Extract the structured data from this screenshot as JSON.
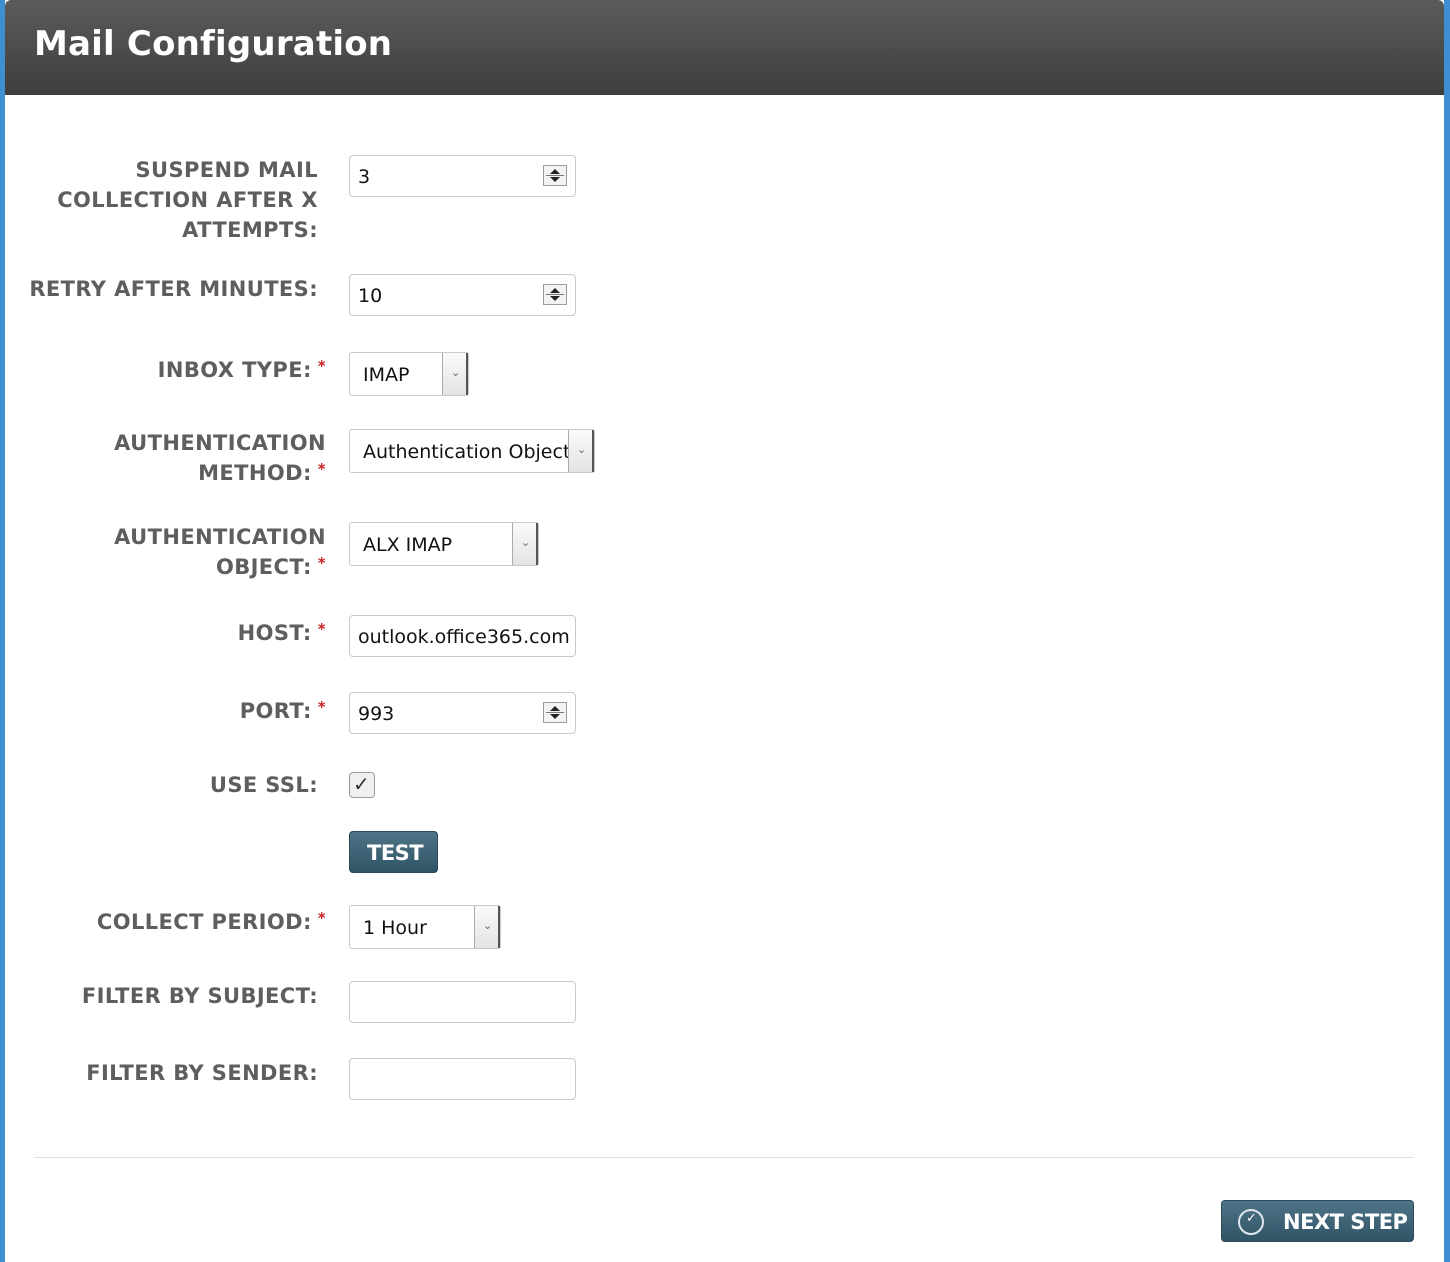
{
  "header": {
    "title": "Mail Configuration"
  },
  "fields": {
    "suspend": {
      "label": "SUSPEND MAIL COLLECTION AFTER X ATTEMPTS:",
      "value": "3"
    },
    "retry": {
      "label": "RETRY AFTER MINUTES:",
      "value": "10"
    },
    "inbox_type": {
      "label": "INBOX TYPE:",
      "value": "IMAP"
    },
    "auth_method": {
      "label": "AUTHENTICATION METHOD:",
      "value": "Authentication Object"
    },
    "auth_object": {
      "label": "AUTHENTICATION OBJECT:",
      "value": "ALX IMAP"
    },
    "host": {
      "label": "HOST:",
      "value": "outlook.office365.com"
    },
    "port": {
      "label": "PORT:",
      "value": "993"
    },
    "use_ssl": {
      "label": "USE SSL:",
      "checked": true
    },
    "collect_period": {
      "label": "COLLECT PERIOD:",
      "value": "1 Hour"
    },
    "filter_subject": {
      "label": "FILTER BY SUBJECT:",
      "value": ""
    },
    "filter_sender": {
      "label": "FILTER BY SENDER:",
      "value": ""
    }
  },
  "required_marker": "*",
  "buttons": {
    "test": "TEST",
    "next": "NEXT STEP"
  },
  "icons": {
    "checkmark": "✓",
    "dropdown": "chevron-down",
    "next_icon": "check-circle"
  },
  "colors": {
    "header_bg": "#4a4a4a",
    "frame_blue": "#3d8fd1",
    "button_bg": "#3c6276",
    "required": "#cc2222"
  }
}
